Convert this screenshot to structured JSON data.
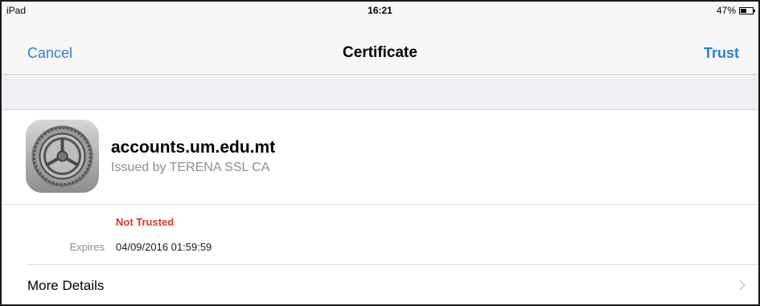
{
  "status_bar": {
    "device": "iPad",
    "time": "16:21",
    "battery_text": "47%",
    "battery_level": 0.47
  },
  "nav": {
    "cancel_label": "Cancel",
    "title": "Certificate",
    "trust_label": "Trust"
  },
  "certificate": {
    "icon": "settings-gear-icon",
    "name": "accounts.um.edu.mt",
    "issuer": "Issued by TERENA SSL CA",
    "trust_status": "Not Trusted",
    "expires_label": "Expires",
    "expires_value": "04/09/2016 01:59:59"
  },
  "more_details": {
    "label": "More Details",
    "icon": "chevron-right-icon"
  },
  "colors": {
    "accent": "#2a7fd4",
    "warning": "#d9352e",
    "secondary_text": "#8e8e93"
  }
}
